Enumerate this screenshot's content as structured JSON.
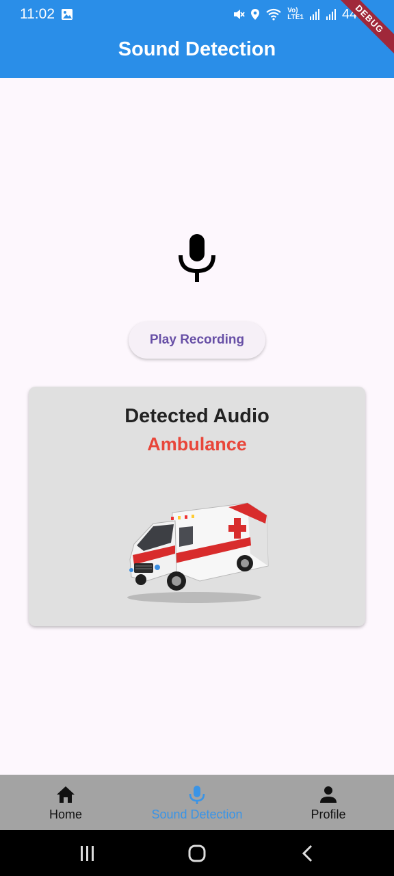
{
  "status_bar": {
    "time": "11:02",
    "network_label_top": "Vo)",
    "network_label_bottom": "LTE1",
    "battery": "44%"
  },
  "app_bar": {
    "title": "Sound Detection",
    "debug_banner": "DEBUG"
  },
  "main": {
    "mic_icon": "mic-icon",
    "play_button_label": "Play Recording"
  },
  "card": {
    "title": "Detected Audio",
    "detected_label": "Ambulance",
    "image": "ambulance-image"
  },
  "bottom_nav": {
    "items": [
      {
        "label": "Home",
        "icon": "home-icon",
        "active": false
      },
      {
        "label": "Sound Detection",
        "icon": "mic-icon",
        "active": true
      },
      {
        "label": "Profile",
        "icon": "person-icon",
        "active": false
      }
    ]
  },
  "colors": {
    "app_bar": "#2a8ee8",
    "background": "#fdf7fd",
    "accent_red": "#e8463a",
    "button_text": "#674fa6",
    "nav_active": "#3a94e6",
    "nav_bg": "#a3a3a3"
  }
}
